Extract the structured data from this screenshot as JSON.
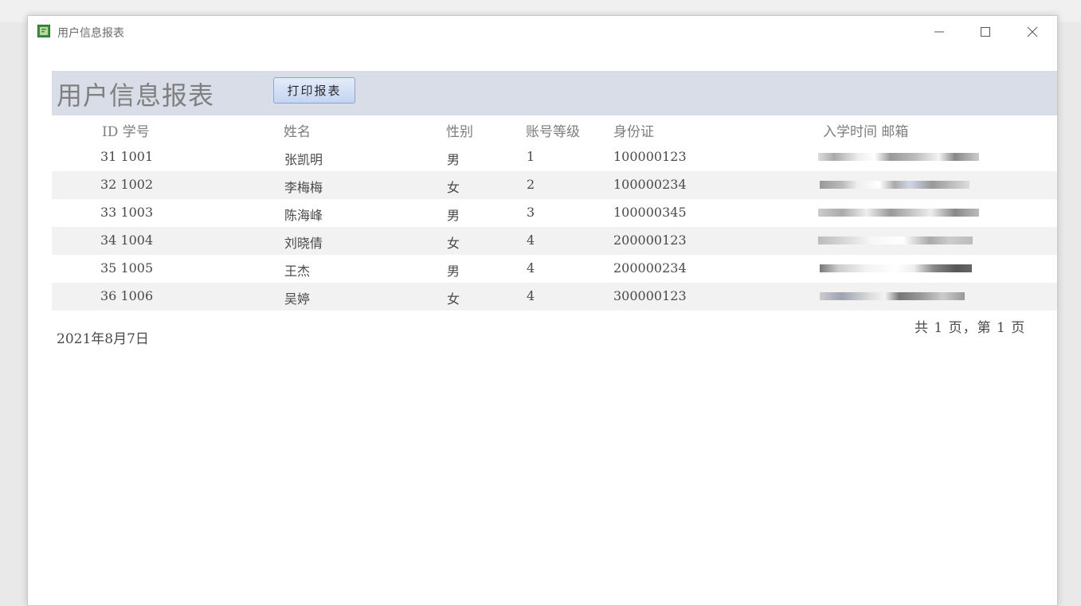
{
  "window": {
    "title": "用户信息报表",
    "icon": "access-report-icon"
  },
  "report": {
    "title": "用户信息报表",
    "print_button_label": "打印报表",
    "columns": {
      "id_no": "ID 学号",
      "name": "姓名",
      "gender": "性别",
      "level": "账号等级",
      "id_card": "身份证",
      "enroll_email": "入学时间 邮箱"
    },
    "rows": [
      {
        "id_no": "31 1001",
        "name": "张凯明",
        "gender": "男",
        "level": "1",
        "id_card": "100000123"
      },
      {
        "id_no": "32 1002",
        "name": "李梅梅",
        "gender": "女",
        "level": "2",
        "id_card": "100000234"
      },
      {
        "id_no": "33 1003",
        "name": "陈海峰",
        "gender": "男",
        "level": "3",
        "id_card": "100000345"
      },
      {
        "id_no": "34 1004",
        "name": "刘晓倩",
        "gender": "女",
        "level": "4",
        "id_card": "200000123"
      },
      {
        "id_no": "35 1005",
        "name": "王杰",
        "gender": "男",
        "level": "4",
        "id_card": "200000234"
      },
      {
        "id_no": "36 1006",
        "name": "吴婷",
        "gender": "女",
        "level": "4",
        "id_card": "300000123"
      }
    ],
    "date": "2021年8月7日",
    "page_info": "共 1 页，第 1 页"
  },
  "colors": {
    "header_band": "#d9dde7",
    "alt_row": "#f2f2f2",
    "button_border": "#8fa4cc"
  }
}
